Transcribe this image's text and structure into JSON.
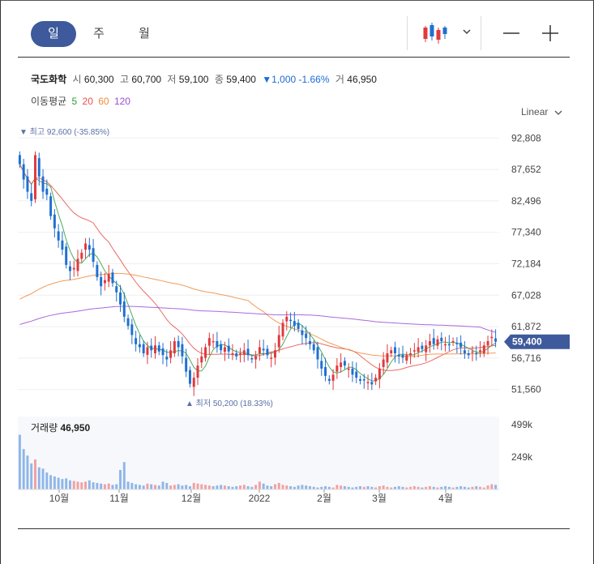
{
  "tabs": [
    {
      "label": "일",
      "active": true
    },
    {
      "label": "주",
      "active": false
    },
    {
      "label": "월",
      "active": false
    }
  ],
  "toolbar": {
    "chart_type_icon": "candlestick-icon",
    "dropdown_icon": "chevron-down-icon",
    "zoom_out_icon": "minus-icon",
    "zoom_in_icon": "plus-icon"
  },
  "quote": {
    "name": "국도화학",
    "open_label": "시",
    "open": "60,300",
    "high_label": "고",
    "high": "60,700",
    "low_label": "저",
    "low": "59,100",
    "close_label": "종",
    "close": "59,400",
    "change": "▼1,000 -1.66%",
    "volume_label": "거",
    "volume": "46,950"
  },
  "moving_average": {
    "label": "이동평균",
    "periods": [
      {
        "label": "5",
        "color": "#2e9e3e"
      },
      {
        "label": "20",
        "color": "#e8504a"
      },
      {
        "label": "60",
        "color": "#f08a3c"
      },
      {
        "label": "120",
        "color": "#9b4fd6"
      }
    ]
  },
  "scale_mode": "Linear",
  "chart_data": {
    "type": "candlestick",
    "y_ticks": [
      "92,808",
      "87,652",
      "82,496",
      "77,340",
      "72,184",
      "67,028",
      "61,872",
      "56,716",
      "51,560"
    ],
    "ylim": [
      49000,
      95500
    ],
    "x_ticks": [
      "10월",
      "11월",
      "12월",
      "2022",
      "2월",
      "3월",
      "4월"
    ],
    "current_price": "59,400",
    "high_marker": "▼ 최고 92,600 (-35.85%)",
    "low_marker": "▲ 최저 50,200 (18.33%)",
    "volume_label": "거래량",
    "volume_value": "46,950",
    "volume_ticks": [
      "499k",
      "249k"
    ],
    "up_color": "#e0393e",
    "down_color": "#1f6fd1",
    "close_series": [
      88500,
      86000,
      84000,
      82500,
      90000,
      86500,
      84000,
      83500,
      80000,
      78000,
      76000,
      74500,
      72000,
      71000,
      71500,
      73000,
      74000,
      75500,
      74500,
      72500,
      70000,
      68500,
      69500,
      70500,
      69000,
      67500,
      65500,
      63500,
      62000,
      60500,
      59000,
      58500,
      57500,
      58500,
      58000,
      58800,
      57800,
      57200,
      56500,
      58000,
      59500,
      58500,
      57000,
      54500,
      52500,
      53500,
      55500,
      57000,
      58500,
      60000,
      59500,
      58500,
      58000,
      58500,
      57800,
      57500,
      57000,
      57500,
      58000,
      57200,
      56500,
      57000,
      58500,
      58000,
      57200,
      56800,
      58000,
      60500,
      62500,
      63500,
      62800,
      62000,
      61500,
      60500,
      60000,
      59000,
      58000,
      56500,
      55000,
      53800,
      53000,
      54000,
      55500,
      56000,
      55500,
      55000,
      54000,
      53500,
      53000,
      53200,
      52800,
      52400,
      53500,
      55000,
      56500,
      57500,
      58000,
      57500,
      57000,
      56800,
      57200,
      57500,
      58000,
      58500,
      58200,
      58800,
      59500,
      59000,
      59800,
      59500,
      59000,
      58800,
      59500,
      59000,
      58500,
      57500,
      57200,
      57800,
      57500,
      58000,
      58800,
      59500,
      60200,
      59400
    ],
    "volume_series": [
      420,
      310,
      260,
      200,
      230,
      170,
      160,
      130,
      110,
      100,
      90,
      80,
      85,
      70,
      65,
      60,
      55,
      60,
      70,
      55,
      50,
      45,
      40,
      45,
      35,
      40,
      150,
      210,
      60,
      50,
      40,
      35,
      30,
      45,
      40,
      35,
      30,
      60,
      50,
      30,
      35,
      40,
      30,
      35,
      25,
      50,
      45,
      40,
      35,
      30,
      25,
      30,
      35,
      30,
      25,
      20,
      25,
      30,
      35,
      25,
      20,
      35,
      60,
      45,
      30,
      25,
      40,
      50,
      35,
      30,
      25,
      20,
      30,
      35,
      30,
      25,
      20,
      15,
      20,
      25,
      20,
      15,
      35,
      30,
      25,
      20,
      15,
      20,
      25,
      20,
      25,
      20,
      15,
      25,
      30,
      20,
      15,
      20,
      25,
      20,
      15,
      20,
      25,
      20,
      15,
      20,
      25,
      20,
      15,
      20,
      25,
      20,
      15,
      20,
      25,
      20,
      15,
      20,
      25,
      20,
      15,
      30,
      40,
      35
    ]
  }
}
